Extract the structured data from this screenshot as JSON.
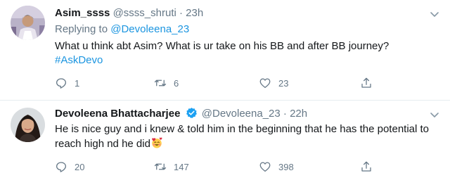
{
  "tweets": [
    {
      "name": "Asim_ssss",
      "handle": "@ssss_shruti",
      "separator": "·",
      "time": "23h",
      "replying_prefix": "Replying to",
      "replying_to": "@Devoleena_23",
      "text": "What u think abt Asim? What is ur take on his BB and after BB journey?",
      "hashtag": "#AskDevo",
      "reply_count": "1",
      "retweet_count": "6",
      "like_count": "23"
    },
    {
      "name": "Devoleena Bhattacharjee",
      "verified": true,
      "handle": "@Devoleena_23",
      "separator": "·",
      "time": "22h",
      "text": "He is nice guy and i knew & told him in the beginning that he has the potential to reach high nd he did",
      "reply_count": "20",
      "retweet_count": "147",
      "like_count": "398"
    }
  ],
  "icons": {
    "reply": "reply-icon",
    "retweet": "retweet-icon",
    "like": "heart-icon",
    "share": "share-icon",
    "menu": "chevron-down-icon",
    "verified": "verified-badge-icon",
    "emoji": "smiling-face-with-hearts-emoji"
  },
  "colors": {
    "link": "#1b95e0",
    "secondary_text": "#657786",
    "verified": "#1da1f2",
    "divider": "#e6ecf0"
  }
}
